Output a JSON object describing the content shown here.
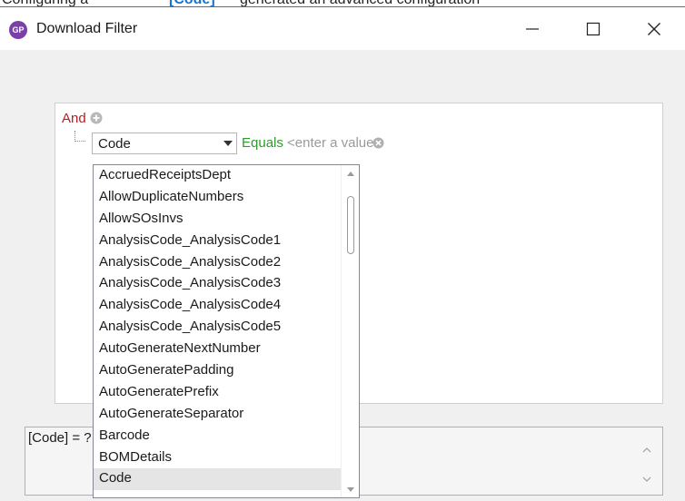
{
  "clipped_header": {
    "frag_a": "Configuring a",
    "frag_link": "[Code]",
    "frag_b": "generated an advanced configuration"
  },
  "window": {
    "title": "Download Filter",
    "icon": "app-logo-icon",
    "controls": [
      "minimize-icon",
      "maximize-icon",
      "close-icon"
    ]
  },
  "filter": {
    "group_operator": "And",
    "condition": {
      "field": "Code",
      "operator": "Equals",
      "value_placeholder": "<enter a value>"
    }
  },
  "dropdown": {
    "items": [
      "AccruedReceiptsDept",
      "AllowDuplicateNumbers",
      "AllowSOsInvs",
      "AnalysisCode_AnalysisCode1",
      "AnalysisCode_AnalysisCode2",
      "AnalysisCode_AnalysisCode3",
      "AnalysisCode_AnalysisCode4",
      "AnalysisCode_AnalysisCode5",
      "AutoGenerateNextNumber",
      "AutoGeneratePadding",
      "AutoGeneratePrefix",
      "AutoGenerateSeparator",
      "Barcode",
      "BOMDetails",
      "Code"
    ],
    "selected": "Code"
  },
  "expression": {
    "text": "[Code] = ?"
  },
  "colors": {
    "and_red": "#b11f1f",
    "equals_green": "#2d9a2d",
    "placeholder_gray": "#9a9a9a",
    "app_icon_purple": "#7b3fa8"
  }
}
